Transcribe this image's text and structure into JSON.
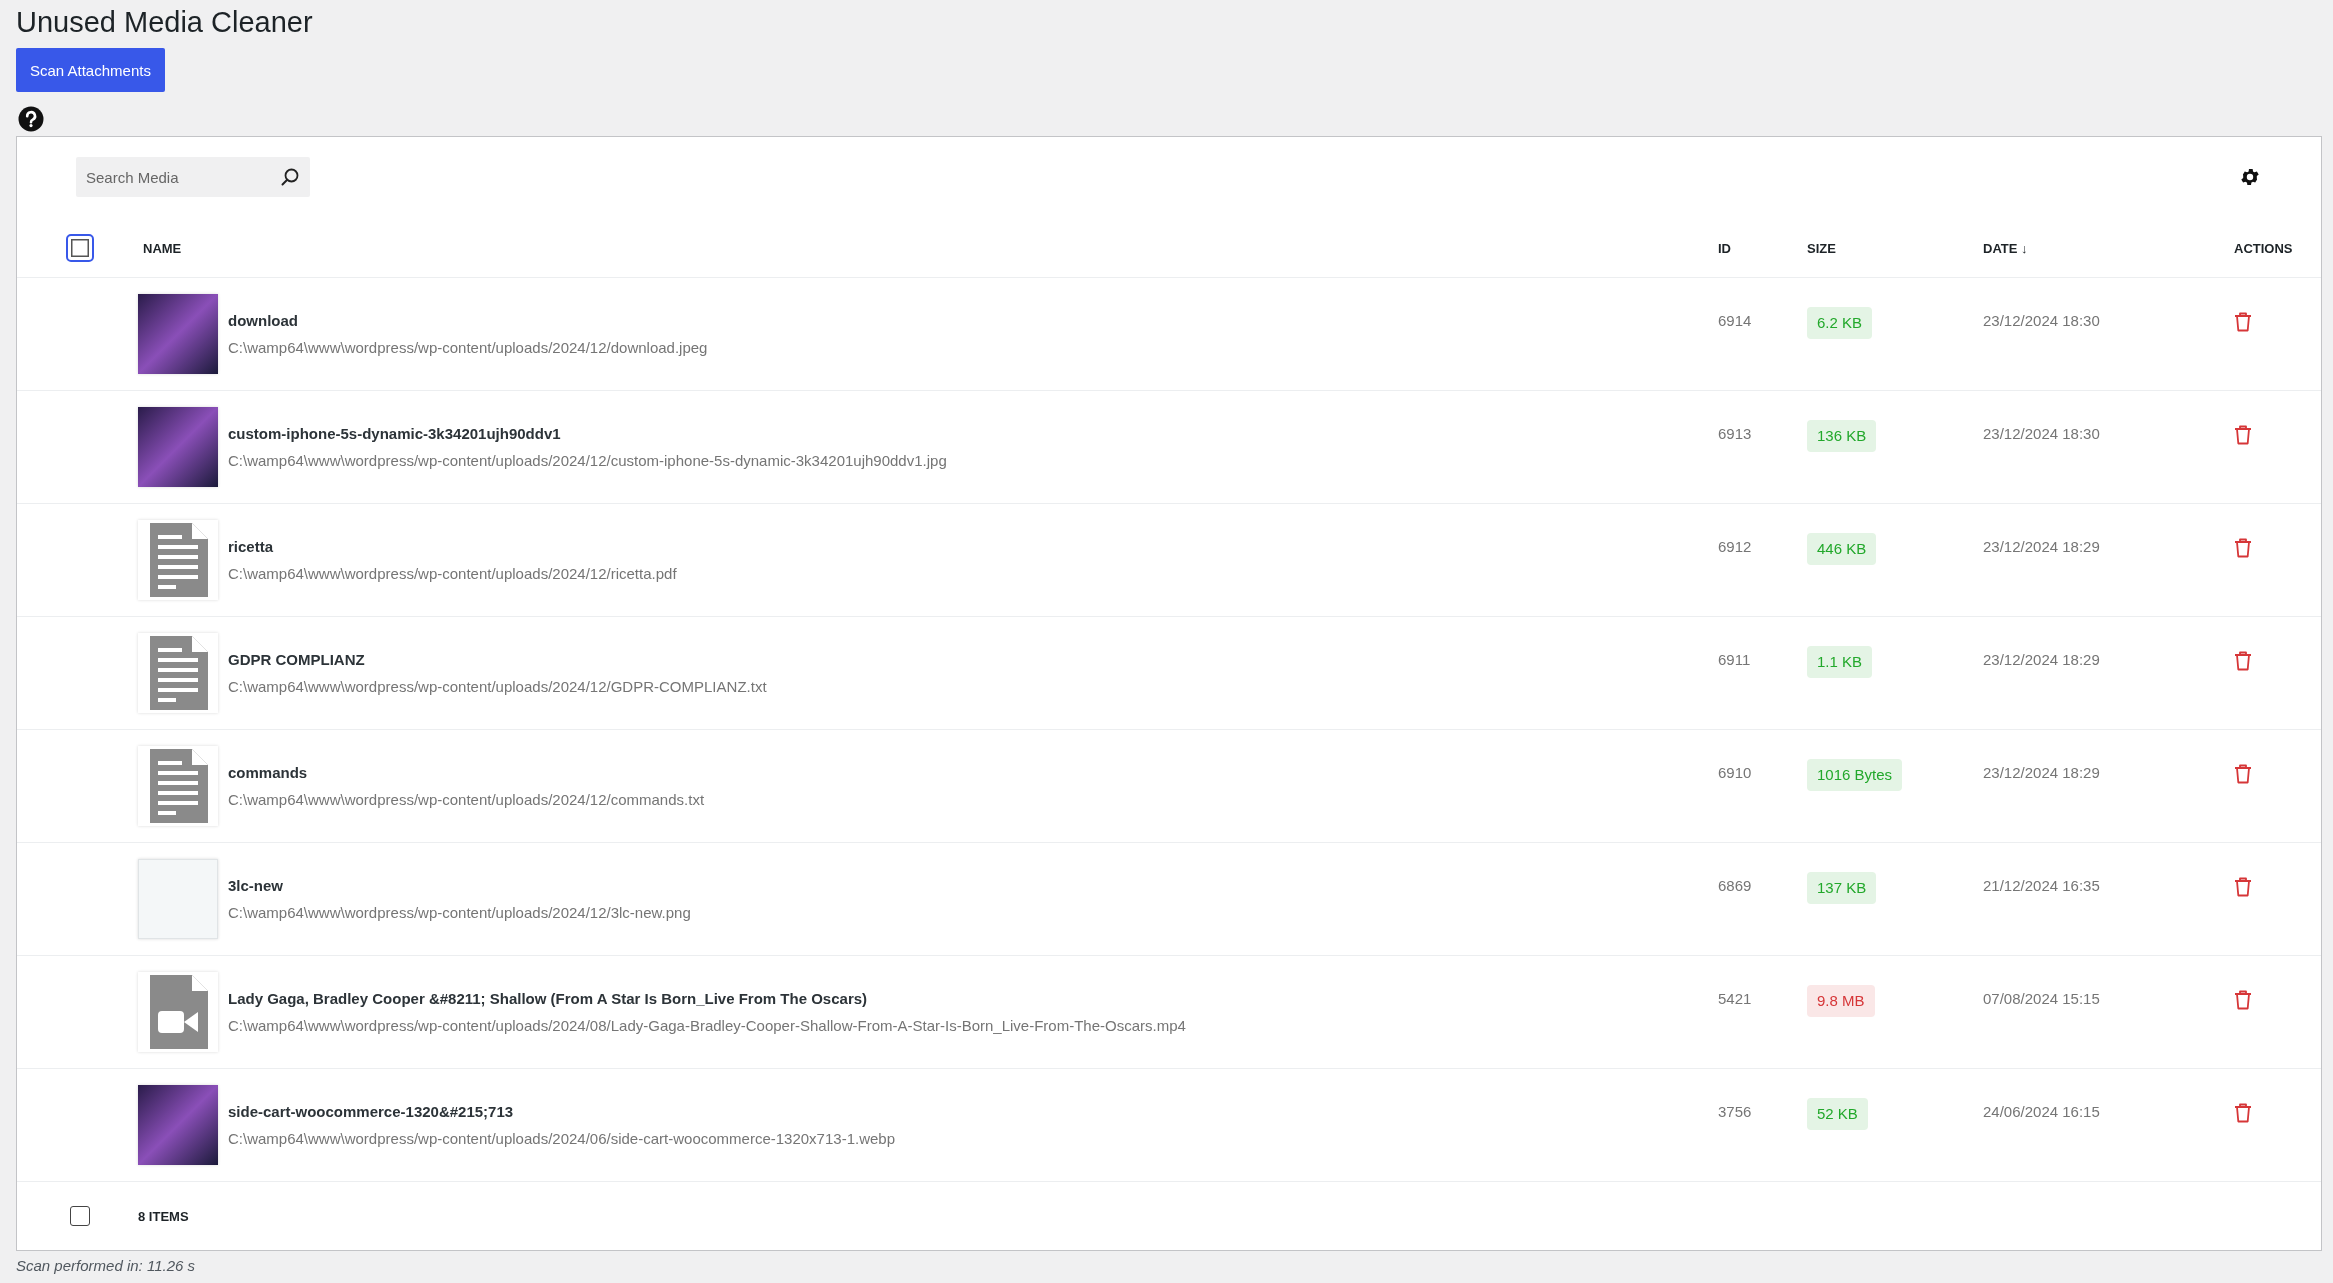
{
  "title": "Unused Media Cleaner",
  "scan_button": "Scan Attachments",
  "search": {
    "placeholder": "Search Media"
  },
  "table": {
    "header_checkbox": {
      "checked": false
    },
    "columns": [
      "NAME",
      "ID",
      "SIZE",
      "DATE ↓",
      "ACTIONS"
    ],
    "rows": [
      {
        "kind": "photo",
        "name": "download",
        "path": "C:\\wamp64\\www\\wordpress/wp-content/uploads/2024/12/download.jpeg",
        "id": "6914",
        "size": "6.2 KB",
        "color": "#22a82b",
        "date": "23/12/2024 18:30"
      },
      {
        "kind": "photo",
        "name": "custom-iphone-5s-dynamic-3k34201ujh90ddv1",
        "path": "C:\\wamp64\\www\\wordpress/wp-content/uploads/2024/12/custom-iphone-5s-dynamic-3k34201ujh90ddv1.jpg",
        "id": "6913",
        "size": "136 KB",
        "color": "#22a82b",
        "date": "23/12/2024 18:30"
      },
      {
        "kind": "document",
        "name": "ricetta",
        "path": "C:\\wamp64\\www\\wordpress/wp-content/uploads/2024/12/ricetta.pdf",
        "id": "6912",
        "size": "446 KB",
        "color": "#22a82b",
        "date": "23/12/2024 18:29"
      },
      {
        "kind": "document",
        "name": "GDPR COMPLIANZ",
        "path": "C:\\wamp64\\www\\wordpress/wp-content/uploads/2024/12/GDPR-COMPLIANZ.txt",
        "id": "6911",
        "size": "1.1 KB",
        "color": "#22a82b",
        "date": "23/12/2024 18:29"
      },
      {
        "kind": "document",
        "name": "commands",
        "path": "C:\\wamp64\\www\\wordpress/wp-content/uploads/2024/12/commands.txt",
        "id": "6910",
        "size": "1016 Bytes",
        "color": "#22a82b",
        "date": "23/12/2024 18:29"
      },
      {
        "kind": "screenshot",
        "name": "3lc-new",
        "path": "C:\\wamp64\\www\\wordpress/wp-content/uploads/2024/12/3lc-new.png",
        "id": "6869",
        "size": "137 KB",
        "color": "#22a82b",
        "date": "21/12/2024 16:35"
      },
      {
        "kind": "video",
        "name": "Lady Gaga, Bradley Cooper &#8211; Shallow (From A Star Is Born_Live From The Oscars)",
        "path": "C:\\wamp64\\www\\wordpress/wp-content/uploads/2024/08/Lady-Gaga-Bradley-Cooper-Shallow-From-A-Star-Is-Born_Live-From-The-Oscars.mp4",
        "id": "5421",
        "size": "9.8 MB",
        "color": "#d63638",
        "date": "07/08/2024 15:15"
      },
      {
        "kind": "photo",
        "name": "side-cart-woocommerce-1320&#215;713",
        "path": "C:\\wamp64\\www\\wordpress/wp-content/uploads/2024/06/side-cart-woocommerce-1320x713-1.webp",
        "id": "3756",
        "size": "52 KB",
        "color": "#22a82b",
        "date": "24/06/2024 16:15"
      }
    ],
    "footer": {
      "checkbox": {
        "checked": false
      },
      "count": "8 ITEMS"
    }
  },
  "status": "Scan performed in: 11.26 s"
}
